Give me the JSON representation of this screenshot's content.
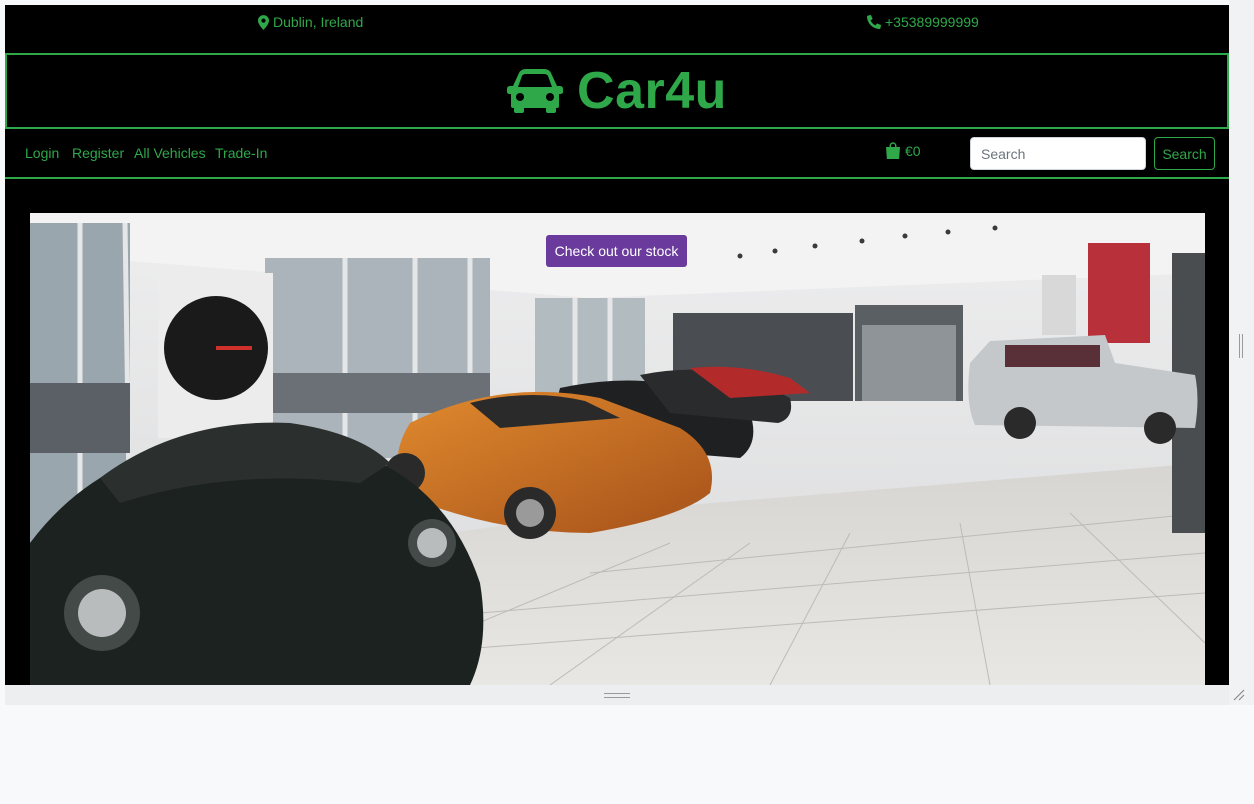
{
  "topbar": {
    "location": "Dublin, Ireland",
    "phone": "+35389999999",
    "location_icon": "map-marker-icon",
    "phone_icon": "phone-icon"
  },
  "brand": {
    "name": "Car4u",
    "icon": "car-icon"
  },
  "nav": {
    "links": [
      {
        "label": "Login"
      },
      {
        "label": "Register"
      },
      {
        "label": "All Vehicles"
      },
      {
        "label": "Trade-In"
      }
    ],
    "cart": {
      "icon": "shopping-bag-icon",
      "total": "€0"
    },
    "search": {
      "placeholder": "Search",
      "button_label": "Search"
    }
  },
  "hero": {
    "cta_label": "Check out our stock"
  },
  "colors": {
    "accent": "#2fa84a",
    "background": "#000000",
    "cta": "#6a3b9c"
  }
}
